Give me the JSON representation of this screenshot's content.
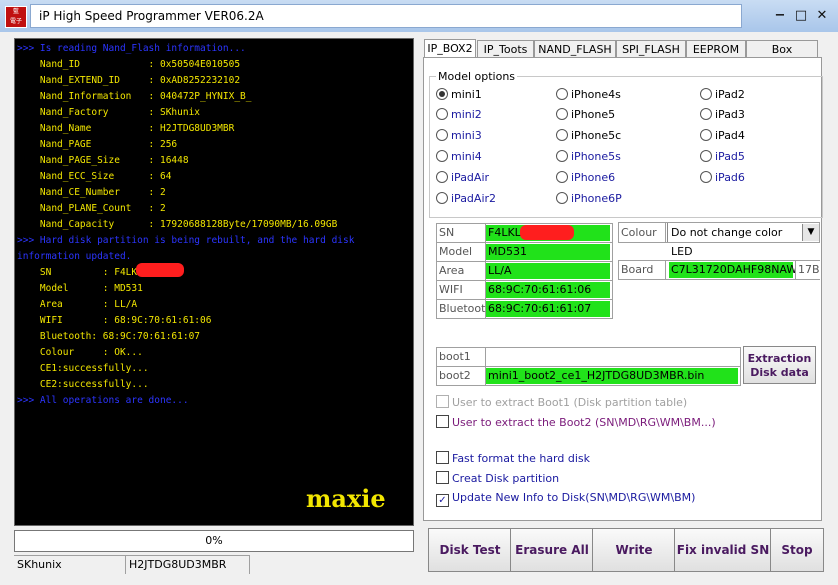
{
  "window": {
    "title": "iP High Speed Programmer VER06.2A",
    "icon_text": "藍\n電子",
    "minimize": "−",
    "maximize": "□",
    "close": "✕"
  },
  "console": {
    "lines": [
      {
        "text": ">>> Is reading Nand_Flash information...",
        "color": "blue"
      },
      {
        "text": "    Nand_ID            : 0x50504E010505",
        "color": "yel"
      },
      {
        "text": "    Nand_EXTEND_ID     : 0xAD8252232102",
        "color": "yel"
      },
      {
        "text": "    Nand_Information   : 040472P_HYNIX_B_",
        "color": "yel"
      },
      {
        "text": "    Nand_Factory       : SKhunix",
        "color": "yel"
      },
      {
        "text": "    Nand_Name          : H2JTDG8UD3MBR",
        "color": "yel"
      },
      {
        "text": "    Nand_PAGE          : 256",
        "color": "yel"
      },
      {
        "text": "    Nand_PAGE_Size     : 16448",
        "color": "yel"
      },
      {
        "text": "    Nand_ECC_Size      : 64",
        "color": "yel"
      },
      {
        "text": "    Nand_CE_Number     : 2",
        "color": "yel"
      },
      {
        "text": "    Nand_PLANE_Count   : 2",
        "color": "yel"
      },
      {
        "text": "    Nand_Capacity      : 17920688128Byte/17090MB/16.09GB",
        "color": "yel"
      },
      {
        "text": ">>> Hard disk partition is being rebuilt, and the hard disk",
        "color": "blue"
      },
      {
        "text": "information updated.",
        "color": "blue"
      },
      {
        "text": "    SN         : F4LKL",
        "color": "yel"
      },
      {
        "text": "    Model      : MD531",
        "color": "yel"
      },
      {
        "text": "    Area       : LL/A",
        "color": "yel"
      },
      {
        "text": "    WIFI       : 68:9C:70:61:61:06",
        "color": "yel"
      },
      {
        "text": "    Bluetooth: 68:9C:70:61:61:07",
        "color": "yel"
      },
      {
        "text": "    Colour     : OK...",
        "color": "yel"
      },
      {
        "text": "    CE1:successfully...",
        "color": "yel"
      },
      {
        "text": "    CE2:successfully...",
        "color": "yel"
      },
      {
        "text": ">>> All operations are done...",
        "color": "blue"
      }
    ],
    "watermark": "maxie"
  },
  "progress": {
    "text": "0%",
    "value_percent": 0
  },
  "statusbar": {
    "factory": "SKhunix",
    "nand_name": "H2JTDG8UD3MBR"
  },
  "tabs": [
    "IP_BOX2",
    "IP_Toots",
    "NAND_FLASH",
    "SPI_FLASH",
    "EEPROM",
    "Box Upgrade"
  ],
  "model_options": {
    "label": "Model options",
    "models": [
      "mini1",
      "iPhone4s",
      "iPad2",
      "mini2",
      "iPhone5",
      "iPad3",
      "mini3",
      "iPhone5c",
      "iPad4",
      "mini4",
      "iPhone5s",
      "iPad5",
      "iPadAir",
      "iPhone6",
      "iPad6",
      "iPadAir2",
      "iPhone6P"
    ],
    "selected": "mini1"
  },
  "device_info": {
    "sn_label": "SN",
    "sn_value": "F4LKL",
    "model_label": "Model",
    "model_value": "MD531",
    "area_label": "Area",
    "area_value": "LL/A",
    "wifi_label": "WIFI",
    "wifi_value": "68:9C:70:61:61:06",
    "bt_label": "Bluetooth",
    "bt_value": "68:9C:70:61:61:07"
  },
  "colour": {
    "label": "Colour",
    "value": "Do not change color LED"
  },
  "board": {
    "label": "Board",
    "value": "C7L31720DAHF98NAW",
    "suffix": "17B"
  },
  "boot": {
    "boot1_label": "boot1",
    "boot1_value": "",
    "boot2_label": "boot2",
    "boot2_value": "mini1_boot2_ce1_H2JTDG8UD3MBR.bin",
    "extract_button": "Extraction Disk data"
  },
  "options": {
    "extract_boot1": {
      "label": "User to extract Boot1 (Disk partition table)",
      "checked": false
    },
    "extract_boot2": {
      "label": "User to extract the Boot2 (SN\\MD\\RG\\WM\\BM...)",
      "checked": false
    },
    "fast_format": {
      "label": "Fast format the hard disk",
      "checked": false
    },
    "create_partition": {
      "label": "Creat Disk partition",
      "checked": false
    },
    "update_info": {
      "label": "Update New Info to Disk(SN\\MD\\RG\\WM\\BM)",
      "checked": true
    }
  },
  "buttons": {
    "disk_test": "Disk Test",
    "erasure_all": "Erasure All",
    "write": "Write",
    "fix_sn": "Fix invalid SN",
    "stop": "Stop"
  },
  "colors": {
    "value_green": "#21e21a",
    "console_yellow": "#f2e600",
    "console_blue": "#2c35ff"
  }
}
